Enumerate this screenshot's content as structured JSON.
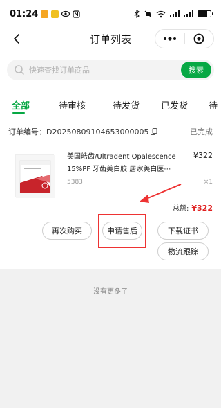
{
  "status_bar": {
    "time": "01:24",
    "signal_text": "4G"
  },
  "nav": {
    "title": "订单列表"
  },
  "search": {
    "placeholder": "快速查找订单商品",
    "button": "搜索"
  },
  "tabs": [
    {
      "label": "全部",
      "active": true
    },
    {
      "label": "待审核",
      "active": false
    },
    {
      "label": "待发货",
      "active": false
    },
    {
      "label": "已发货",
      "active": false
    },
    {
      "label": "待",
      "active": false
    }
  ],
  "order": {
    "number_label": "订单编号：",
    "number": "D20250809104653000005",
    "status": "已完成",
    "product": {
      "title_line1": "美国皓齿/Ultradent Opalescence",
      "title_line2": "15%PF 牙齿美白胶 居家美白医⋯",
      "price": "¥322",
      "sku": "5383",
      "qty": "×1"
    },
    "total_label": "总额:",
    "total_value": "¥322",
    "buttons": {
      "rebuy": "再次购买",
      "after_sale": "申请售后",
      "download_cert": "下载证书",
      "track_logistics": "物流跟踪"
    }
  },
  "footer": {
    "no_more": "没有更多了"
  },
  "colors": {
    "accent": "#07a844",
    "price_red": "#e02020",
    "annotation_red": "#e33333"
  }
}
